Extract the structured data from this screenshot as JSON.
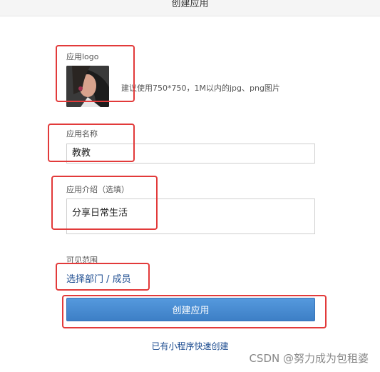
{
  "header": {
    "title": "创建应用"
  },
  "logo": {
    "label": "应用logo",
    "hint": "建议使用750*750，1M以内的jpg、png图片",
    "image_icon": "app-logo-portrait"
  },
  "app_name": {
    "label": "应用名称",
    "value": "教教"
  },
  "app_intro": {
    "label": "应用介绍（选填）",
    "value": "分享日常生活"
  },
  "visibility": {
    "label": "可见范围",
    "link": "选择部门 / 成员"
  },
  "create_button": {
    "label": "创建应用"
  },
  "mini_program_link": "已有小程序快速创建",
  "watermark": "CSDN @努力成为包租婆",
  "colors": {
    "accent": "#3d7fc6",
    "link": "#1a4a8f",
    "annotation": "#e23a3a"
  }
}
